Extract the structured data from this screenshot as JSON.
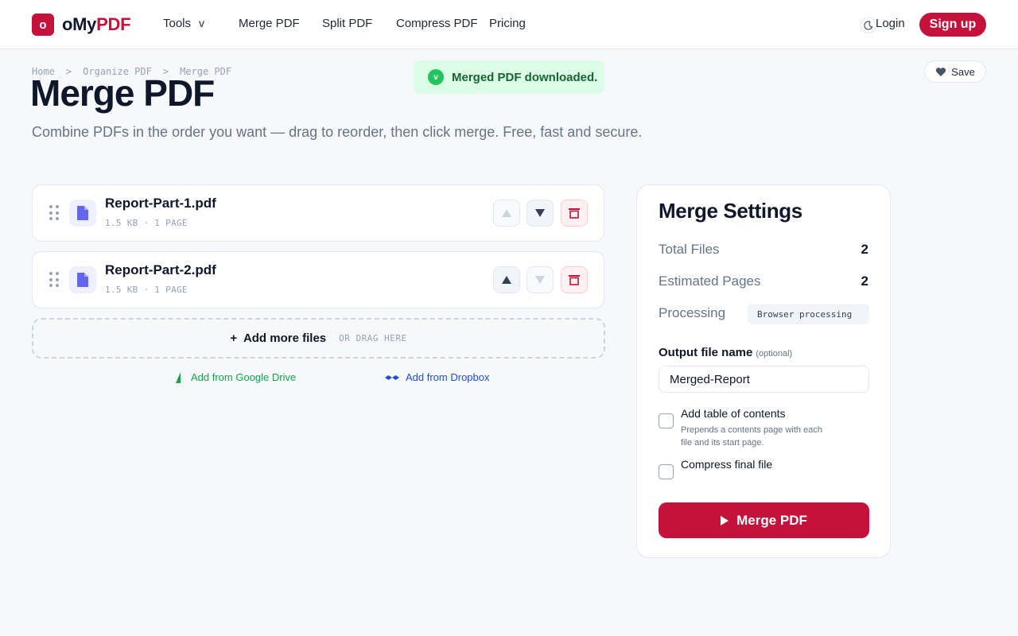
{
  "header": {
    "logo_mark": "o",
    "logo_text_a": "oMy",
    "logo_text_b": "PDF",
    "nav": {
      "tools": "Tools",
      "tools_caret": "v",
      "merge": "Merge PDF",
      "split": "Split PDF",
      "compress": "Compress PDF",
      "pricing": "Pricing"
    },
    "login": "Login",
    "signup": "Sign up"
  },
  "breadcrumb": {
    "items": [
      "Home",
      "Organize PDF",
      "Merge PDF"
    ],
    "separator": ">"
  },
  "page": {
    "title": "Merge PDF",
    "subtitle": "Combine PDFs in the order you want — drag to reorder, then click merge. Free, fast and secure."
  },
  "toast": {
    "icon": "v",
    "message": "Merged PDF downloaded."
  },
  "save": {
    "label": "Save"
  },
  "files": [
    {
      "name": "Report-Part-1.pdf",
      "meta": "1.5 KB · 1 PAGE",
      "move_up_enabled": false,
      "move_down_enabled": true
    },
    {
      "name": "Report-Part-2.pdf",
      "meta": "1.5 KB · 1 PAGE",
      "move_up_enabled": true,
      "move_down_enabled": false
    }
  ],
  "add_more": {
    "plus": "+",
    "label": "Add more files",
    "hint": "OR DRAG HERE"
  },
  "sources": {
    "gdrive": "Add from Google Drive",
    "dropbox": "Add from Dropbox"
  },
  "settings": {
    "title": "Merge Settings",
    "total_files_label": "Total Files",
    "total_files_value": "2",
    "estimated_pages_label": "Estimated Pages",
    "estimated_pages_value": "2",
    "processing_label": "Processing",
    "processing_value": "Browser processing",
    "output_label": "Output file name",
    "output_optional": "(optional)",
    "output_value": "Merged-Report",
    "toc_label": "Add table of contents",
    "toc_help": "Prepends a contents page with each file and its start page.",
    "toc_checked": false,
    "compress_label": "Compress final file",
    "compress_checked": false,
    "merge_button": "Merge PDF"
  },
  "colors": {
    "brand": "#c4123c",
    "success": "#22c55e",
    "gdrive": "#16a34a",
    "dropbox": "#1d4ed8",
    "file_icon": "#6366f1"
  }
}
